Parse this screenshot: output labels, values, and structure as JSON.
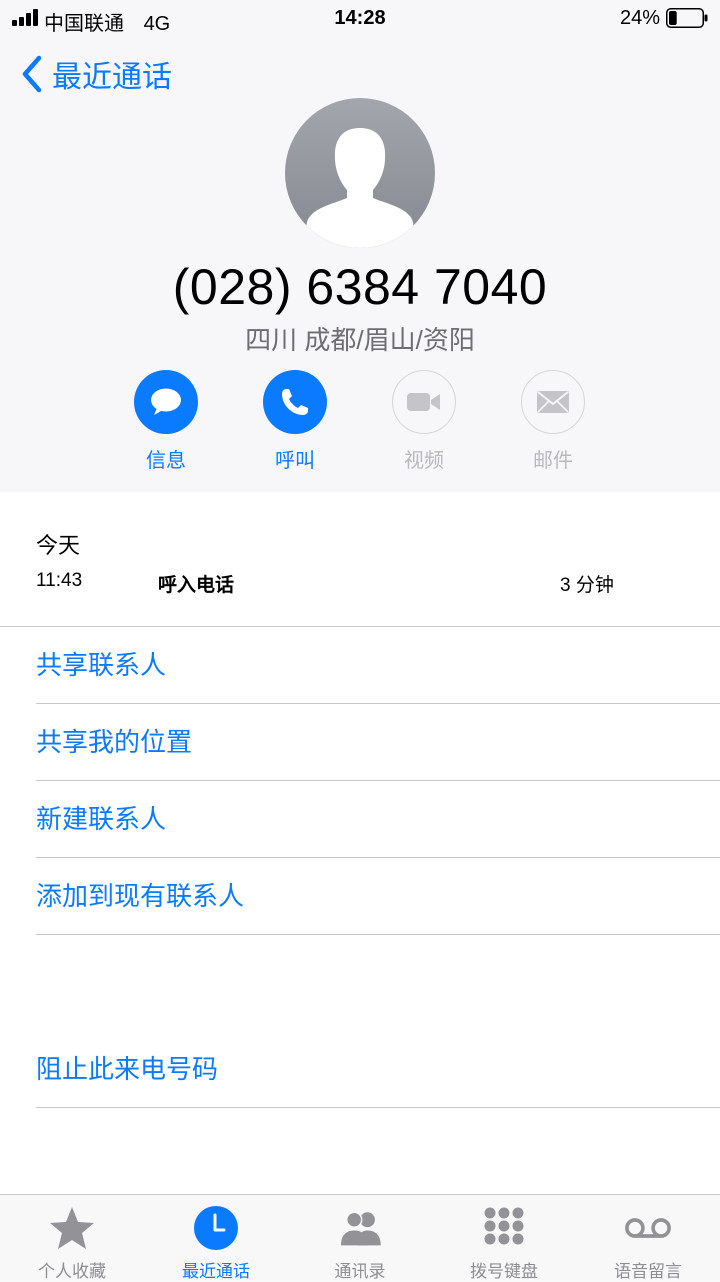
{
  "status_bar": {
    "carrier": "中国联通",
    "network": "4G",
    "time": "14:28",
    "battery_percent": "24%",
    "battery_level": 0.24
  },
  "nav": {
    "back_label": "最近通话",
    "back_icon": "chevron-left-icon"
  },
  "contact": {
    "avatar_icon": "person-silhouette-icon",
    "phone_number": "(028) 6384 7040",
    "location": "四川 成都/眉山/资阳"
  },
  "actions": [
    {
      "label": "信息",
      "icon": "message-bubble-icon",
      "enabled": true
    },
    {
      "label": "呼叫",
      "icon": "phone-icon",
      "enabled": true
    },
    {
      "label": "视频",
      "icon": "video-camera-icon",
      "enabled": false
    },
    {
      "label": "邮件",
      "icon": "mail-icon",
      "enabled": false
    }
  ],
  "call_log": {
    "day": "今天",
    "entries": [
      {
        "time": "11:43",
        "type": "呼入电话",
        "duration": "3 分钟"
      }
    ]
  },
  "menu": {
    "share_contact": "共享联系人",
    "share_location": "共享我的位置",
    "new_contact": "新建联系人",
    "add_to_existing": "添加到现有联系人",
    "block_caller": "阻止此来电号码"
  },
  "tab_bar": {
    "tabs": [
      {
        "label": "个人收藏",
        "icon": "star-icon",
        "active": false
      },
      {
        "label": "最近通话",
        "icon": "clock-icon",
        "active": true
      },
      {
        "label": "通讯录",
        "icon": "contacts-icon",
        "active": false
      },
      {
        "label": "拨号键盘",
        "icon": "keypad-icon",
        "active": false
      },
      {
        "label": "语音留言",
        "icon": "voicemail-icon",
        "active": false
      }
    ]
  },
  "colors": {
    "accent": "#0a7aff",
    "header_background": "#f7f7fa",
    "secondary_text": "#6d6d72",
    "disabled": "#b9b9be",
    "separator": "#c8c7cc"
  }
}
